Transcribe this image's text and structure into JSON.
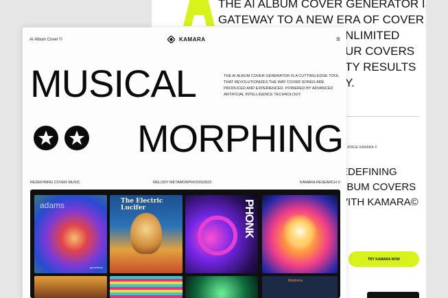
{
  "back_page": {
    "headline_lines": [
      "THE AI ALBUM COVER GENERATOR IS THE",
      "GATEWAY TO A NEW ERA OF COVER SONG",
      "NLIMITED",
      "UR COVERS",
      "TY RESULTS",
      "Y."
    ],
    "small_label": "ATAGE KAMARA ©",
    "tagline_lines": [
      "EDEFINING",
      "LBUM COVERS",
      "VITH KAMARA©"
    ],
    "cta_label": "TRY KAMARA NOW",
    "accent_color": "#d8f21b"
  },
  "header": {
    "left_text": "AI Album Cover ©",
    "brand": "KAMARA",
    "brand_icon": "diamond-logo-icon",
    "menu_icon": "hamburger-menu-icon",
    "menu_glyph": "≡"
  },
  "hero": {
    "title_line1": "MUSICAL",
    "title_line2": "MORPHING",
    "description": "THE AI ALBUM COVER GENERATOR IS A CUTTING-EDGE TOOL THAT REVOLUTIONIZES THE WAY COVER SONGS ARE PRODUCED AND EXPERIENCED. POWERED BY ADVANCED ARTIFICIAL INTELLIGENCE TECHNOLOGY.",
    "badges": [
      "star-icon",
      "star-icon"
    ]
  },
  "meta_row": {
    "left": "REDEFINING COVER MUSIC",
    "center": "MELODY METAMORPHOSIS/2023",
    "right": "KAMARA RESEARCH ©"
  },
  "gallery": {
    "covers": [
      {
        "title": "adams",
        "subtitle": "gemeinbar"
      },
      {
        "title": "The Electric Lucifer"
      },
      {
        "title": "PHONK"
      },
      {
        "title": ""
      },
      {
        "title": ""
      },
      {
        "title": ""
      },
      {
        "title": ""
      },
      {
        "title": "Madonna"
      }
    ]
  }
}
